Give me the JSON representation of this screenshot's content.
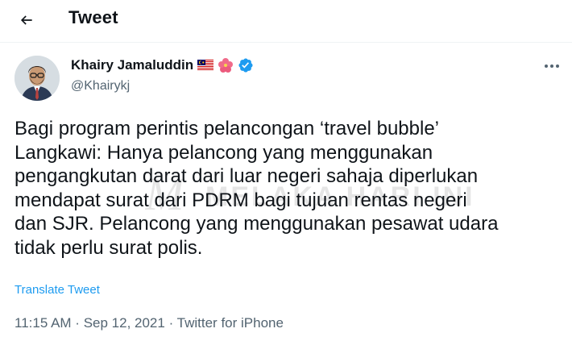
{
  "header": {
    "title": "Tweet",
    "back_icon": "arrow-left-icon"
  },
  "author": {
    "name": "Khairy Jamaluddin",
    "handle": "@Khairykj",
    "badges": [
      "malaysia-flag-icon",
      "hibiscus-icon",
      "verified-badge-icon"
    ],
    "verified_color": "#1d9bf0"
  },
  "tweet": {
    "text": "Bagi program perintis pelancongan ‘travel bubble’\nLangkawi: Hanya pelancong yang menggunakan\npengangkutan darat dari luar negeri sahaja diperlukan\nmendapat surat dari PDRM bagi tujuan rentas negeri\ndan SJR. Pelancong yang menggunakan pesawat udara\ntidak perlu surat polis.",
    "translate_label": "Translate Tweet"
  },
  "meta": {
    "time": "11:15 AM",
    "sep1": " · ",
    "date": "Sep 12, 2021",
    "sep2": " · ",
    "source": "Twitter for iPhone"
  },
  "watermark": {
    "text": "MELAKA HARI INI"
  },
  "colors": {
    "link": "#1d9bf0",
    "secondary": "#536471",
    "primary": "#0f1419"
  }
}
